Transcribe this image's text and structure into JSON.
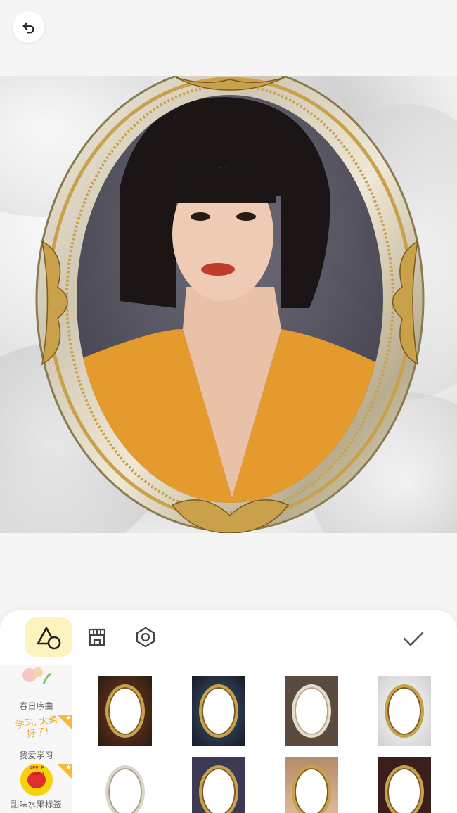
{
  "toolbar": {
    "back_icon": "undo-icon",
    "tools": [
      {
        "name": "shape-tool",
        "icon": "triangle-circle-icon",
        "active": true
      },
      {
        "name": "store-tool",
        "icon": "store-icon",
        "active": false
      },
      {
        "name": "hex-tool",
        "icon": "hexagon-icon",
        "active": false
      }
    ],
    "confirm_icon": "check-icon"
  },
  "categories": [
    {
      "label": "春日序曲",
      "premium": false
    },
    {
      "label": "我爱学习",
      "premium": true,
      "sticker_text": "学习, 太美好了!"
    },
    {
      "label": "甜味水果标签",
      "premium": true,
      "sticker_text": "APPLE TODAY"
    }
  ],
  "colors": {
    "accent_yellow": "#fdf3bf",
    "frame_gold": "#c9a14a",
    "badge_orange": "#f6b93b"
  }
}
